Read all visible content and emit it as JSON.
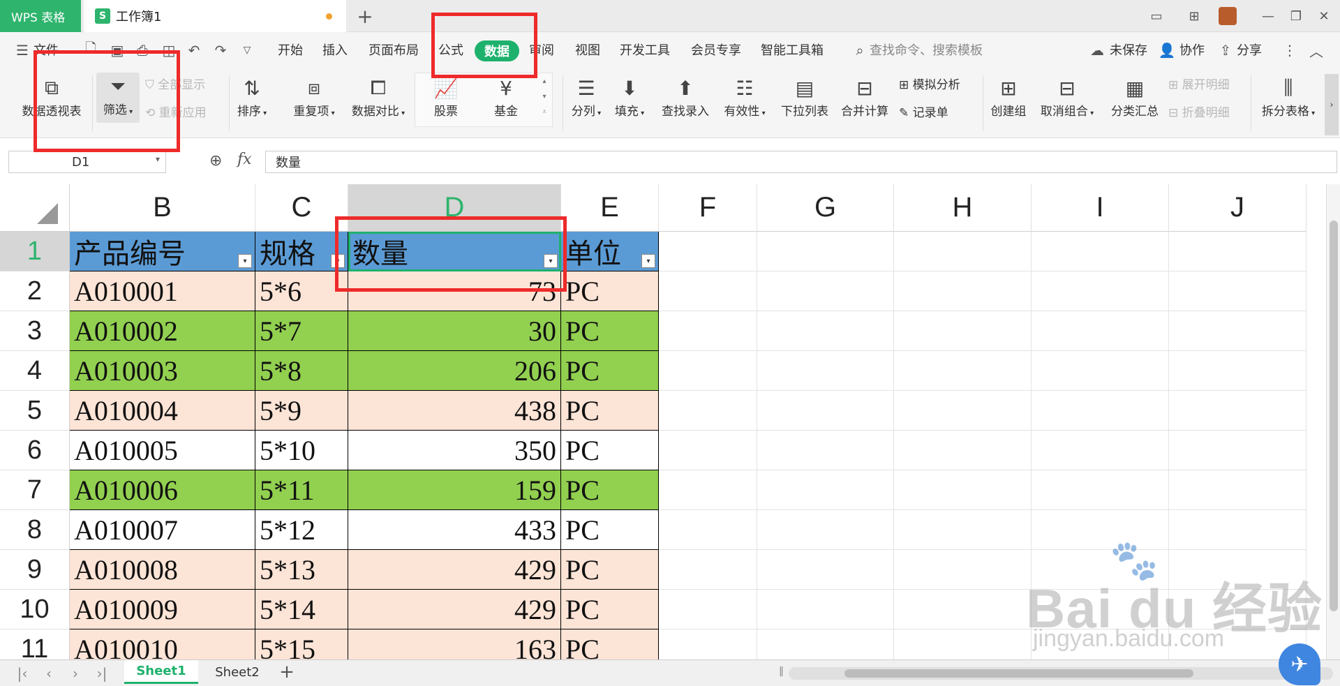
{
  "titlebar": {
    "app_tab": "WPS 表格",
    "doc_logo": "S",
    "doc_title": "工作簿1",
    "new_tab": "+"
  },
  "menu": {
    "file": "文件",
    "items": [
      "开始",
      "插入",
      "页面布局",
      "公式",
      "数据",
      "审阅",
      "视图",
      "开发工具",
      "会员专享",
      "智能工具箱"
    ],
    "active": "数据",
    "search": "查找命令、搜索模板",
    "unsaved": "未保存",
    "collab": "协作",
    "share": "分享"
  },
  "ribbon": {
    "pivot": "数据透视表",
    "filter": "筛选",
    "show_all": "全部显示",
    "reapply": "重新应用",
    "sort": "排序",
    "duplicates": "重复项",
    "compare": "数据对比",
    "stocks": "股票",
    "funds": "基金",
    "split": "分列",
    "fill": "填充",
    "lookup": "查找录入",
    "validity": "有效性",
    "dropdown": "下拉列表",
    "consolidate": "合并计算",
    "simulate": "模拟分析",
    "record": "记录单",
    "group": "创建组",
    "ungroup": "取消组合",
    "subtotal": "分类汇总",
    "expand": "展开明细",
    "collapse": "折叠明细",
    "split_table": "拆分表格"
  },
  "formula": {
    "cell_ref": "D1",
    "fx": "fx",
    "content": "数量"
  },
  "grid": {
    "columns": [
      "B",
      "C",
      "D",
      "E",
      "F",
      "G",
      "H",
      "I",
      "J"
    ],
    "active_column": "D",
    "row_numbers": [
      "1",
      "2",
      "3",
      "4",
      "5",
      "6",
      "7",
      "8",
      "9",
      "10",
      "11"
    ],
    "active_row": "1",
    "header": [
      "产品编号",
      "规格",
      "数量",
      "单位"
    ],
    "rows": [
      {
        "code": "A010001",
        "spec": "5*6",
        "qty": "73",
        "unit": "PC",
        "fill": "#fce4d6"
      },
      {
        "code": "A010002",
        "spec": "5*7",
        "qty": "30",
        "unit": "PC",
        "fill": "#92d050"
      },
      {
        "code": "A010003",
        "spec": "5*8",
        "qty": "206",
        "unit": "PC",
        "fill": "#92d050"
      },
      {
        "code": "A010004",
        "spec": "5*9",
        "qty": "438",
        "unit": "PC",
        "fill": "#fce4d6"
      },
      {
        "code": "A010005",
        "spec": "5*10",
        "qty": "350",
        "unit": "PC",
        "fill": "#ffffff"
      },
      {
        "code": "A010006",
        "spec": "5*11",
        "qty": "159",
        "unit": "PC",
        "fill": "#92d050"
      },
      {
        "code": "A010007",
        "spec": "5*12",
        "qty": "433",
        "unit": "PC",
        "fill": "#ffffff"
      },
      {
        "code": "A010008",
        "spec": "5*13",
        "qty": "429",
        "unit": "PC",
        "fill": "#fce4d6"
      },
      {
        "code": "A010009",
        "spec": "5*14",
        "qty": "429",
        "unit": "PC",
        "fill": "#fce4d6"
      },
      {
        "code": "A010010",
        "spec": "5*15",
        "qty": "163",
        "unit": "PC",
        "fill": "#fce4d6"
      }
    ]
  },
  "sheets": {
    "tabs": [
      "Sheet1",
      "Sheet2"
    ],
    "active": "Sheet1",
    "add": "+"
  },
  "watermark": {
    "brand": "Bai du 经验",
    "url": "jingyan.baidu.com"
  },
  "colors": {
    "accent": "#1eb16d",
    "header_fill": "#5b9bd5",
    "highlight": "#ee2a2a"
  }
}
